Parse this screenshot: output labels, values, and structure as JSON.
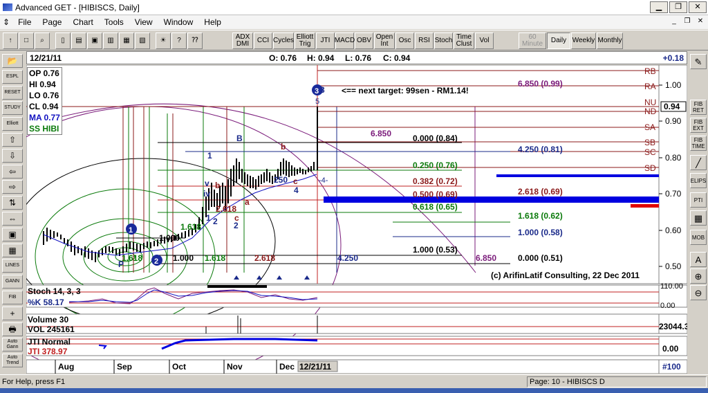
{
  "window": {
    "title": "Advanced GET - [HIBISCS, Daily]"
  },
  "window_controls": {
    "minimize": "0",
    "restore": "1",
    "close": "r"
  },
  "menu": [
    "File",
    "Page",
    "Chart",
    "Tools",
    "View",
    "Window",
    "Help"
  ],
  "toolbar": {
    "indicators": [
      "ADX DMI",
      "CCI",
      "Cycles",
      "Elliott Trig",
      "JTI",
      "MACD",
      "OBV",
      "Open Int",
      "Osc",
      "RSI",
      "Stoch",
      "Time Clust",
      "Vol"
    ],
    "timeframes": [
      "60 Minute",
      "Daily",
      "Weekly",
      "Monthly"
    ],
    "active_timeframe": "Daily"
  },
  "left_tools": [
    "open",
    "ESPL",
    "RESET",
    "STUDY",
    "Elliott",
    "up",
    "down",
    "left",
    "right",
    "zoom",
    "expand",
    "fit",
    "grid",
    "LINES",
    "GANN",
    "FIB",
    "add",
    "print",
    "Auto Gann",
    "Auto Trend"
  ],
  "right_tools": [
    "pencil",
    "FIB RET",
    "FIB EXT",
    "FIB TIME",
    "line",
    "ELIPS",
    "PTI",
    "grid",
    "MOB",
    "text",
    "zoom-in",
    "zoom-out"
  ],
  "info_bar": {
    "date": "12/21/11",
    "open": "O: 0.76",
    "high": "H: 0.94",
    "low": "L: 0.76",
    "close": "C: 0.94",
    "change": "+0.18"
  },
  "ohlc_legend": [
    {
      "text": "OP 0.76",
      "color": "#000000"
    },
    {
      "text": "HI 0.94",
      "color": "#000000"
    },
    {
      "text": "LO 0.76",
      "color": "#000000"
    },
    {
      "text": "CL 0.94",
      "color": "#000000"
    },
    {
      "text": "MA 0.77",
      "color": "#1010c0"
    },
    {
      "text": "SS HIBI",
      "color": "#0a7a0a"
    }
  ],
  "price_axis": [
    "1.00",
    "0.90",
    "0.80",
    "0.70",
    "0.60",
    "0.50"
  ],
  "current_price_label": "0.94",
  "pti_labels": [
    "RB",
    "RA",
    "NU",
    "ND",
    "SA",
    "SB",
    "SC",
    "SD"
  ],
  "annotations": {
    "target_note": "<== next target: 99sen - RM1.14!",
    "copyright": "(c) ArifinLatif Consulting, 22 Dec 2011",
    "wave5": "5",
    "wave4": "-4-"
  },
  "fib_levels_black": [
    "0.000 (0.84)",
    "1.000 (0.53)",
    "0.000 (0.51)"
  ],
  "fib_levels_navy": [
    "4.250 (0.81)",
    "1.000 (0.58)"
  ],
  "fib_levels_green": [
    "0.250 (0.76)",
    "0.618 (0.65)",
    "1.618 (0.62)"
  ],
  "fib_levels_red": [
    "0.382 (0.72)",
    "0.500 (0.69)",
    "2.618 (0.69)"
  ],
  "fib_levels_purple": [
    "6.850 (0.99)",
    "6.850"
  ],
  "extension_labels": [
    "1.000",
    "1.000",
    "1.618",
    "2.618",
    "4.250",
    "6.850",
    "1.618",
    "2.618",
    "250",
    "1.618"
  ],
  "wave_labels": [
    "1",
    "2",
    "3",
    "B",
    "b",
    "a",
    "c",
    "v",
    "iv",
    "1",
    "2",
    "4",
    "P",
    "c",
    "b"
  ],
  "stoch": {
    "title": "Stoch 14, 3, 3",
    "k": "%K  58.17",
    "top_axis": "110.00",
    "bottom_axis": "0.00"
  },
  "volume": {
    "title": "Volume 30",
    "value": "VOL 245161",
    "axis": "23044.3"
  },
  "jti": {
    "title": "JTI Normal",
    "value": "JTI  378.97",
    "axis": "0.00"
  },
  "date_axis": [
    "Aug",
    "Sep",
    "Oct",
    "Nov",
    "Dec"
  ],
  "date_current": "12/21/11",
  "page_indicator": "#100",
  "status": {
    "help": "For Help, press F1",
    "page": "Page: 10 - HIBISCS D"
  },
  "colors": {
    "bg": "#d4d0c8",
    "chart_bg": "#ffffff",
    "blue_line": "#0000e0",
    "red": "#e00000",
    "dark_red": "#8b1a1a",
    "green": "#0a7a0a",
    "navy": "#1a2a8a",
    "purple": "#7a1a7a"
  }
}
